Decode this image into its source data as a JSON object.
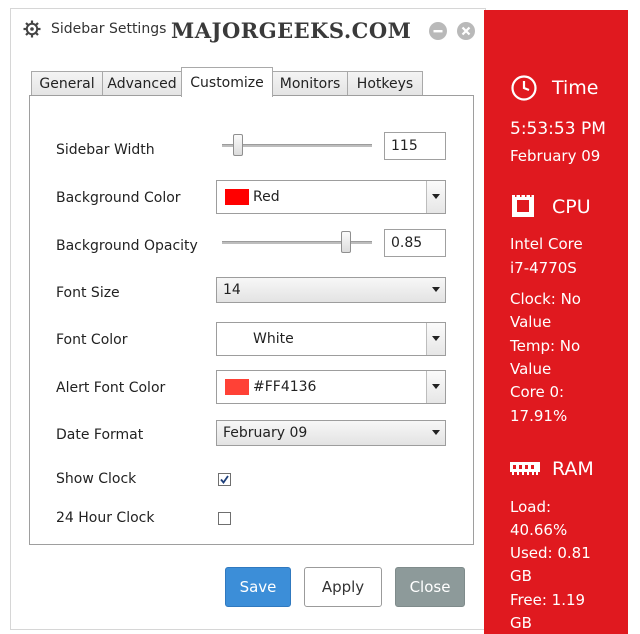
{
  "window": {
    "title": "Sidebar Settings",
    "watermark": "MAJORGEEKS.COM"
  },
  "tabs": [
    {
      "label": "General",
      "active": false
    },
    {
      "label": "Advanced",
      "active": false
    },
    {
      "label": "Customize",
      "active": true
    },
    {
      "label": "Monitors",
      "active": false
    },
    {
      "label": "Hotkeys",
      "active": false
    }
  ],
  "settings": {
    "sidebar_width": {
      "label": "Sidebar Width",
      "value": "115",
      "slider_fraction": 0.08
    },
    "background_color": {
      "label": "Background Color",
      "value": "Red",
      "swatch": "#ff0000"
    },
    "background_opacity": {
      "label": "Background Opacity",
      "value": "0.85",
      "slider_fraction": 0.85
    },
    "font_size": {
      "label": "Font Size",
      "value": "14"
    },
    "font_color": {
      "label": "Font Color",
      "value": "White",
      "swatch": "#ffffff"
    },
    "alert_font_color": {
      "label": "Alert Font Color",
      "value": "#FF4136",
      "swatch": "#ff4136"
    },
    "date_format": {
      "label": "Date Format",
      "value": "February 09"
    },
    "show_clock": {
      "label": "Show Clock",
      "checked": true
    },
    "hour24_clock": {
      "label": "24 Hour Clock",
      "checked": false
    }
  },
  "buttons": {
    "save": "Save",
    "apply": "Apply",
    "close": "Close"
  },
  "sidebar": {
    "background": "#e0191f",
    "time": {
      "heading": "Time",
      "clock": "5:53:53 PM",
      "date": "February 09"
    },
    "cpu": {
      "heading": "CPU",
      "model_line1": "Intel Core",
      "model_line2": "i7-4770S",
      "clock_line1": "Clock: No",
      "clock_line2": "Value",
      "temp_line1": "Temp: No",
      "temp_line2": "Value",
      "core_line1": "Core 0:",
      "core_line2": "17.91%"
    },
    "ram": {
      "heading": "RAM",
      "load_line1": "Load:",
      "load_line2": "40.66%",
      "used_line1": "Used: 0.81",
      "used_line2": "GB",
      "free_line1": "Free: 1.19",
      "free_line2": "GB"
    }
  },
  "icons": {
    "title": "gear-icon",
    "minimize": "minimize-icon",
    "close": "close-icon",
    "time": "clock-icon",
    "cpu": "cpu-icon",
    "ram": "ram-icon"
  }
}
